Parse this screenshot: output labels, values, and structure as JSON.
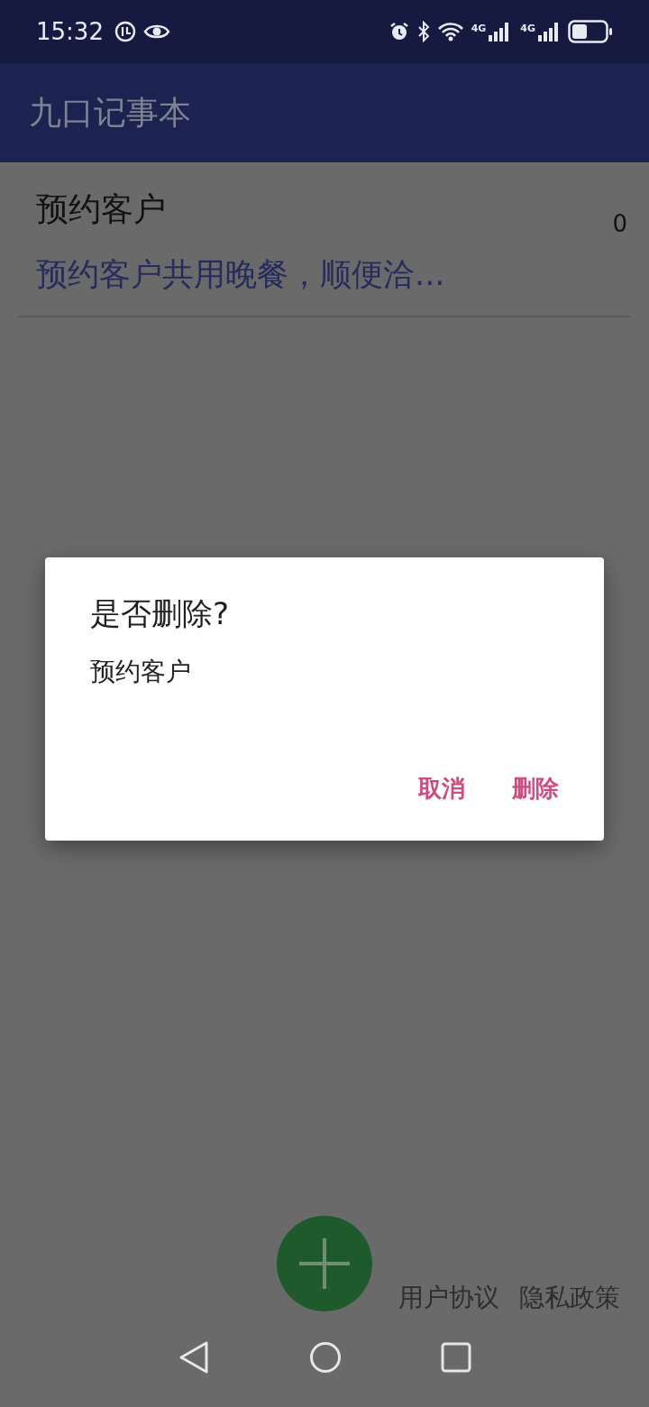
{
  "status_bar": {
    "time": "15:32",
    "networks": [
      "4G",
      "4G"
    ]
  },
  "app_bar": {
    "title": "九口记事本"
  },
  "notes": [
    {
      "title": "预约客户",
      "count": "0",
      "preview": "预约客户共用晚餐，顺便洽..."
    }
  ],
  "dialog": {
    "title": "是否删除?",
    "message": "预约客户",
    "buttons": [
      "取消",
      "删除"
    ]
  },
  "footer_links": [
    "用户协议",
    "隐私政策"
  ]
}
